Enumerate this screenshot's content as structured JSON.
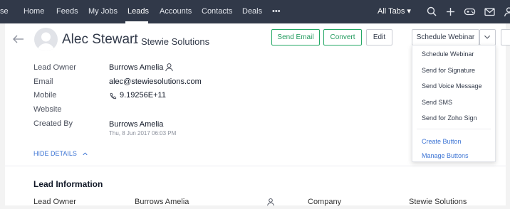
{
  "nav": {
    "items": [
      {
        "label": "se"
      },
      {
        "label": "Home"
      },
      {
        "label": "Feeds"
      },
      {
        "label": "My Jobs"
      },
      {
        "label": "Leads"
      },
      {
        "label": "Accounts"
      },
      {
        "label": "Contacts"
      },
      {
        "label": "Deals"
      },
      {
        "label": "•••"
      }
    ],
    "active": "Leads",
    "all_tabs": "All Tabs ▾",
    "icons": [
      "search-icon",
      "plus-icon",
      "gamepad-icon",
      "mail-icon",
      "user-icon"
    ]
  },
  "record": {
    "name": "Alec Stewart",
    "separator": "-",
    "company": "Stewie Solutions"
  },
  "actions": {
    "send_email": "Send Email",
    "convert": "Convert",
    "edit": "Edit",
    "schedule_webinar": "Schedule Webinar"
  },
  "fields": {
    "lead_owner_label": "Lead Owner",
    "lead_owner_value": "Burrows Amelia",
    "email_label": "Email",
    "email_value": "alec@stewiesolutions.com",
    "mobile_label": "Mobile",
    "mobile_value": "9.19256E+11",
    "website_label": "Website",
    "created_by_label": "Created By",
    "created_by_value": "Burrows Amelia",
    "created_time": "Thu, 8 Jun 2017 06:03 PM"
  },
  "hide_details": "HIDE DETAILS",
  "lead_information": {
    "title": "Lead Information",
    "lead_owner_label": "Lead Owner",
    "lead_owner_value": "Burrows Amelia",
    "company_label": "Company",
    "company_value": "Stewie Solutions"
  },
  "dropdown": {
    "items": [
      "Schedule Webinar",
      "Send for Signature",
      "Send Voice Message",
      "Send SMS",
      "Send for Zoho Sign"
    ],
    "links": [
      "Create Button",
      "Manage Buttons"
    ]
  },
  "colors": {
    "nav_bg": "#313949",
    "accent_green": "#25a866",
    "link_blue": "#3c74d4"
  }
}
